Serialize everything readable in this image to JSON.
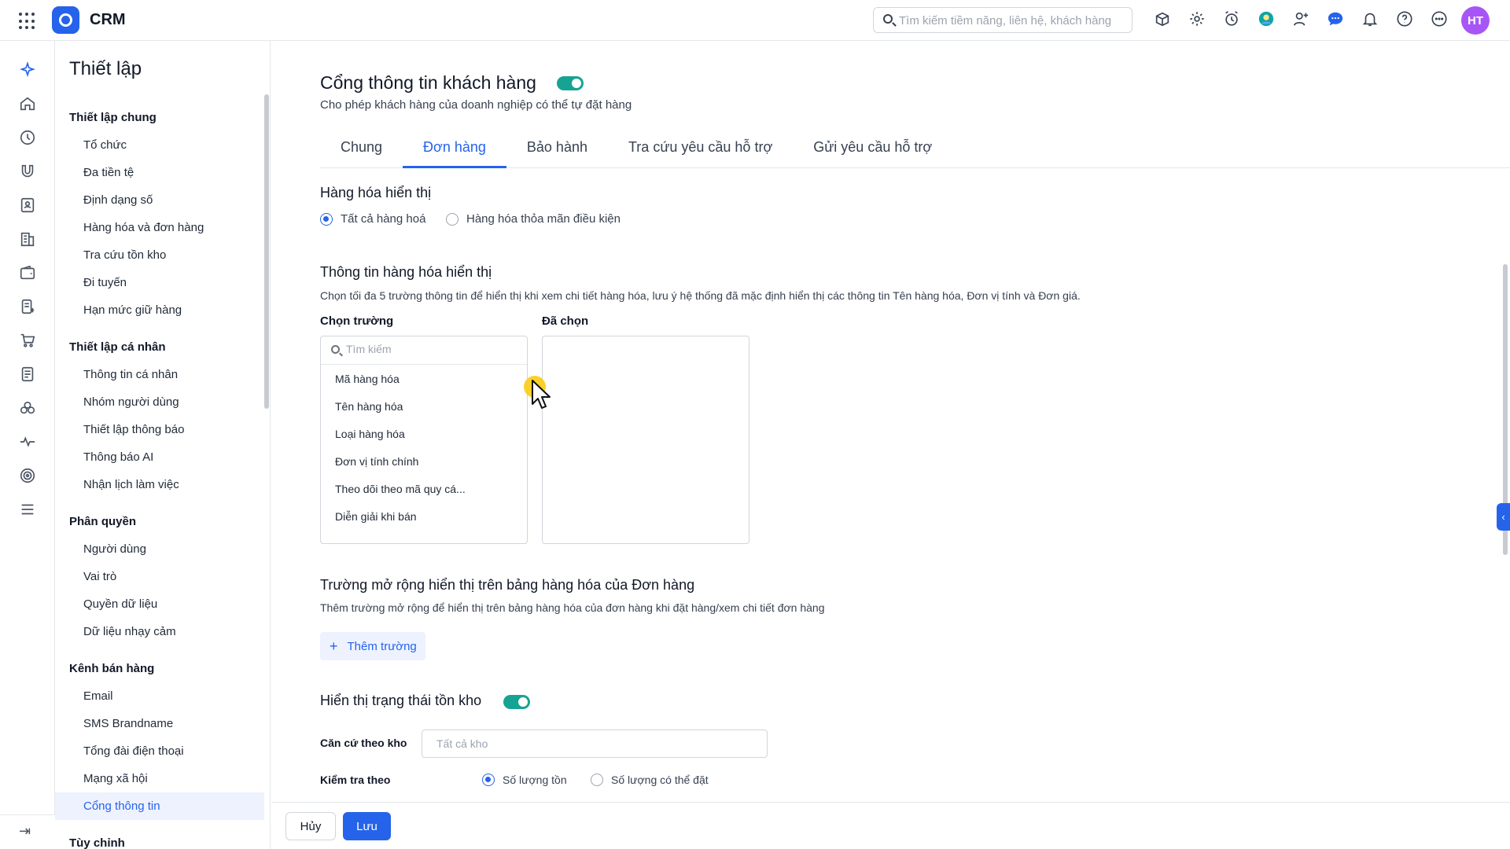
{
  "app": {
    "title": "CRM",
    "avatar_initials": "HT"
  },
  "search": {
    "placeholder": "Tìm kiếm tiềm năng, liên hệ, khách hàng"
  },
  "top_icons": [
    "store-icon",
    "gear-icon",
    "alarm-clock-icon",
    "sync-avatar-icon",
    "add-user-icon",
    "chat-icon",
    "bell-icon",
    "help-icon",
    "more-icon"
  ],
  "rail_icons": [
    "sparkle-icon",
    "home-icon",
    "dashboard-icon",
    "magnet-icon",
    "contact-card-icon",
    "building-icon",
    "wallet-icon",
    "invoice-icon",
    "cart-icon",
    "document-icon",
    "group-icon",
    "activity-icon",
    "target-icon",
    "menu-icon"
  ],
  "nav": {
    "title": "Thiết lập",
    "groups": [
      {
        "label": "Thiết lập chung",
        "items": [
          "Tổ chức",
          "Đa tiền tệ",
          "Định dạng số",
          "Hàng hóa và đơn hàng",
          "Tra cứu tồn kho",
          "Đi tuyến",
          "Hạn mức giữ hàng"
        ]
      },
      {
        "label": "Thiết lập cá nhân",
        "items": [
          "Thông tin cá nhân",
          "Nhóm người dùng",
          "Thiết lập thông báo",
          "Thông báo AI",
          "Nhận lịch làm việc"
        ]
      },
      {
        "label": "Phân quyền",
        "items": [
          "Người dùng",
          "Vai trò",
          "Quyền dữ liệu",
          "Dữ liệu nhạy cảm"
        ]
      },
      {
        "label": "Kênh bán hàng",
        "items": [
          "Email",
          "SMS Brandname",
          "Tổng đài điện thoại",
          "Mạng xã hội",
          "Cổng thông tin"
        ]
      },
      {
        "label": "Tùy chỉnh",
        "items": []
      }
    ],
    "active_item": "Cổng thông tin"
  },
  "main": {
    "title": "Cổng thông tin khách hàng",
    "title_toggle_on": true,
    "subtitle": "Cho phép khách hàng của doanh nghiệp có thể tự đặt hàng",
    "tabs": [
      "Chung",
      "Đơn hàng",
      "Bảo hành",
      "Tra cứu yêu cầu hỗ trợ",
      "Gửi yêu cầu hỗ trợ"
    ],
    "active_tab": "Đơn hàng",
    "display_goods": {
      "title": "Hàng hóa hiển thị",
      "options": [
        "Tất cả hàng hoá",
        "Hàng hóa thỏa mãn điều kiện"
      ],
      "selected": "Tất cả hàng hoá"
    },
    "goods_info": {
      "title": "Thông tin hàng hóa hiển thị",
      "description": "Chọn tối đa 5 trường thông tin để hiển thị khi xem chi tiết hàng hóa, lưu ý hệ thống đã mặc định hiển thị các thông tin Tên hàng hóa, Đơn vị tính và Đơn giá.",
      "choose_label": "Chọn trường",
      "chosen_label": "Đã chọn",
      "search_placeholder": "Tìm kiếm",
      "fields": [
        "Mã hàng hóa",
        "Tên hàng hóa",
        "Loại hàng hóa",
        "Đơn vị tính chính",
        "Theo dõi theo mã quy cá...",
        "Diễn giải khi bán"
      ]
    },
    "extended_fields": {
      "title": "Trường mở rộng hiển thị trên bảng hàng hóa của Đơn hàng",
      "description": "Thêm trường mở rộng để hiển thị trên bảng hàng hóa của đơn hàng khi đặt hàng/xem chi tiết đơn hàng",
      "add_button": "Thêm trường"
    },
    "stock_status": {
      "title": "Hiển thị trạng thái tồn kho",
      "toggle_on": true,
      "warehouse_label": "Căn cứ theo kho",
      "warehouse_placeholder": "Tất cả kho",
      "check_label": "Kiểm tra theo",
      "check_options": [
        "Số lượng tồn",
        "Số lượng có thể đặt"
      ],
      "check_selected": "Số lượng tồn"
    }
  },
  "footer": {
    "cancel": "Hủy",
    "save": "Lưu"
  }
}
